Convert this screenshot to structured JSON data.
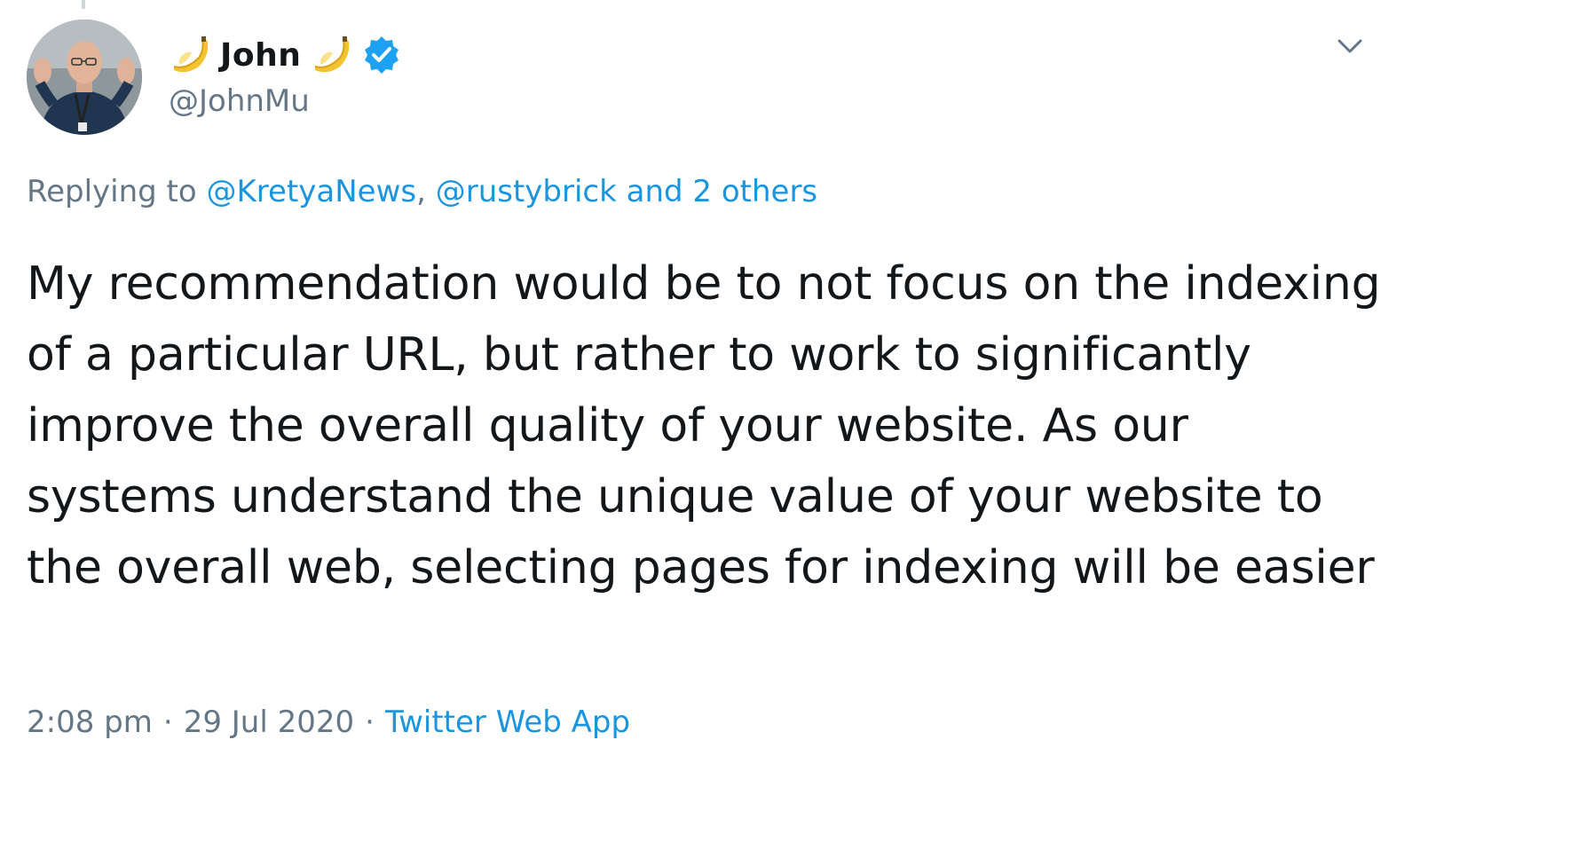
{
  "tweet": {
    "author": {
      "display_name": "John",
      "handle": "@JohnMu",
      "verified": true,
      "name_emoji": "banana-emoji"
    },
    "replying": {
      "prefix": "Replying to",
      "mentions": [
        "@KretyaNews",
        "@rustybrick"
      ],
      "separator": ",",
      "others": "and 2 others"
    },
    "text": "My recommendation would be to not focus on the indexing of a particular URL, but rather to work to significantly improve the overall quality of your website. As our systems understand the unique value of your website to the overall web, selecting pages for indexing will be easier",
    "time": "2:08 pm",
    "date": "29 Jul 2020",
    "dot": "·",
    "source": "Twitter Web App"
  },
  "icons": {
    "verified": "verified-badge-icon",
    "menu": "chevron-down-icon",
    "emoji": "banana-emoji"
  },
  "colors": {
    "link": "#1b95e0",
    "muted": "#657786",
    "text": "#14171a",
    "verified": "#1da1f2"
  }
}
